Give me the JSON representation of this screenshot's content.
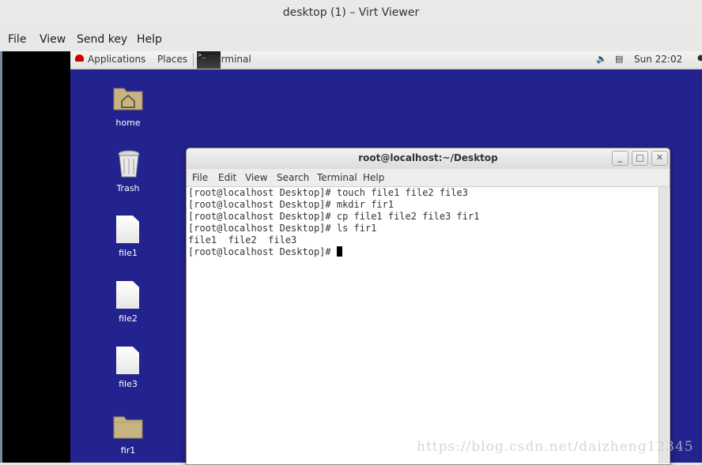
{
  "window": {
    "title": "desktop (1) – Virt Viewer"
  },
  "viewer_menu": [
    "File",
    "View",
    "Send key",
    "Help"
  ],
  "panel": {
    "applications": "Applications",
    "places": "Places",
    "task": "Terminal",
    "clock": "Sun 22:02"
  },
  "desktop_icons": {
    "home": "home",
    "trash": "Trash",
    "file1": "file1",
    "file2": "file2",
    "file3": "file3",
    "fir1": "fir1"
  },
  "terminal": {
    "title": "root@localhost:~/Desktop",
    "menu": [
      "File",
      "Edit",
      "View",
      "Search",
      "Terminal",
      "Help"
    ],
    "lines": [
      "[root@localhost Desktop]# touch file1 file2 file3",
      "[root@localhost Desktop]# mkdir fir1",
      "[root@localhost Desktop]# cp file1 file2 file3 fir1",
      "[root@localhost Desktop]# ls fir1",
      "file1  file2  file3",
      "[root@localhost Desktop]# "
    ]
  },
  "watermark": "https://blog.csdn.net/daizheng12345",
  "colors": {
    "desktop_bg": "#23238f",
    "folder": "#c8b382"
  }
}
